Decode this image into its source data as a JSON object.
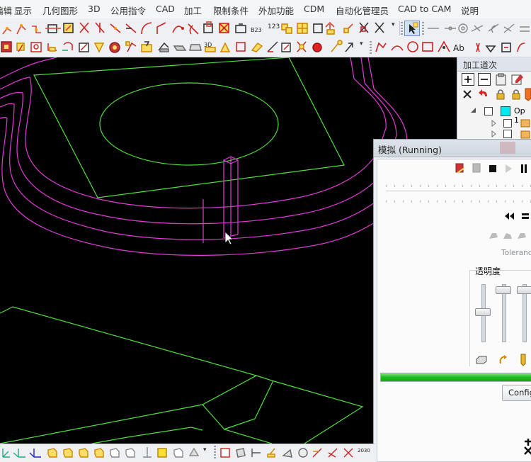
{
  "menu": {
    "items": [
      "编辑",
      "显示",
      "几何图形",
      "3D",
      "公用指令",
      "CAD",
      "加工",
      "限制条件",
      "外加功能",
      "CDM",
      "自动化管理员",
      "CAD to CAM",
      "说明"
    ]
  },
  "toolbar": {
    "label_123": "123",
    "label_b23": "B23",
    "label_3d": "3D",
    "label_ab": "Ab",
    "label_2030": "2030"
  },
  "operations_panel": {
    "title": "加工道次",
    "op_label": "Op 1"
  },
  "simulation": {
    "title": "模拟 (Running)",
    "tolerance_label": "Tolerance",
    "transparency_label": "透明度",
    "config_button": "Config",
    "progress_percent": 100,
    "transparency_levels": [
      0.55,
      0.05,
      0.05
    ]
  },
  "colors": {
    "geometry": "#4fe03a",
    "toolpath": "#e23ad6",
    "viewport_bg": "#000000",
    "progress": "#22c022"
  }
}
